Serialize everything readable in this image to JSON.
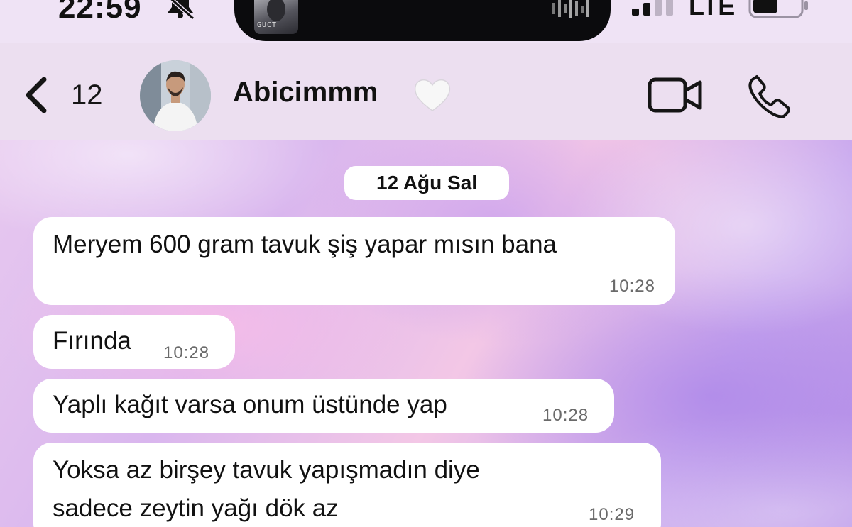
{
  "status_bar": {
    "time": "22:59",
    "network": "LTE",
    "icons": [
      "bell-slash-icon",
      "signal-icon",
      "battery-icon"
    ],
    "now_playing_art_text": "GUCT"
  },
  "header": {
    "back_count": "12",
    "contact_name": "Abicimmm",
    "name_emoji": "white-heart-icon",
    "icons": [
      "chevron-left-icon",
      "video-camera-icon",
      "phone-icon"
    ]
  },
  "chat": {
    "date_label": "12 Ağu Sal",
    "messages": [
      {
        "text": "Meryem 600 gram tavuk şiş yapar mısın bana",
        "time": "10:28"
      },
      {
        "text": "Fırında",
        "time": "10:28"
      },
      {
        "text": "Yaplı kağıt varsa onum üstünde yap",
        "time": "10:28"
      },
      {
        "text_lines": [
          "Yoksa az birşey tavuk yapışmadın diye",
          "sadece zeytin yağı dök az"
        ],
        "time": "10:29"
      }
    ]
  },
  "colors": {
    "header_bg": "#ecdff0",
    "bubble_bg": "#ffffff",
    "text": "#111111",
    "time_text": "#6a6a6a"
  }
}
